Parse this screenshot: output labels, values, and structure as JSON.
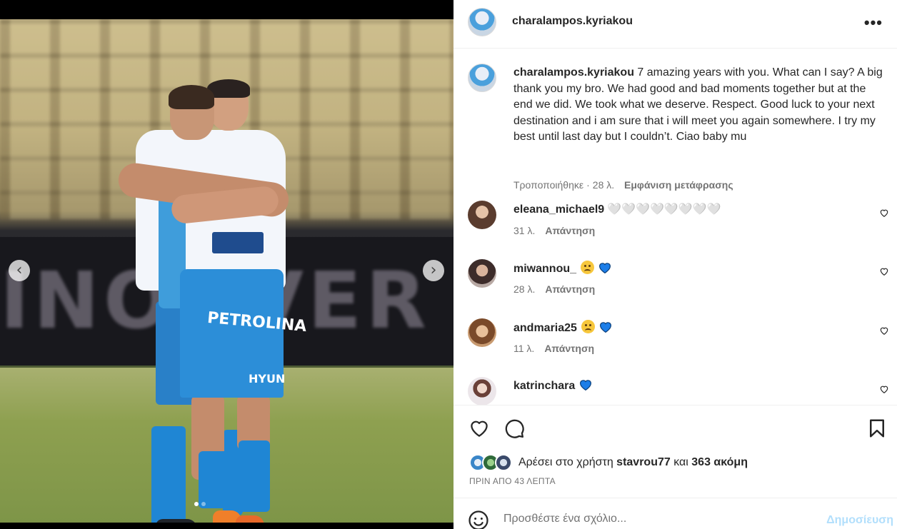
{
  "post": {
    "username": "charalampos.kyriakou",
    "more_label": "•••",
    "caption_text": "7 amazing years with you. What can I say? A big thank you my bro. We had good and bad moments together but at the end we did. We took what we deserve. Respect. Good luck to your next destination and i am sure that i will meet you again somewhere. I try my best until last day but I couldn’t. Ciao baby mu",
    "caption_edited": "Τροποποιήθηκε",
    "caption_age": "28 λ.",
    "translate_label": "Εμφάνιση μετάφρασης",
    "reply_label": "Απάντηση"
  },
  "media": {
    "background_text": "INOUVER P",
    "shorts_sponsor": "PETROLINA",
    "shorts_brand": "HYUN",
    "prev_icon": "chevron-left-icon",
    "next_icon": "chevron-right-icon",
    "page_dots": 2,
    "active_dot": 1
  },
  "comments": [
    {
      "username": "eleana_michael9",
      "text": "🤍🤍🤍🤍🤍🤍🤍🤍",
      "age": "31 λ.",
      "avatar_color": "#7a5a48",
      "emojis": []
    },
    {
      "username": "miwannou_",
      "text": "",
      "age": "28 λ.",
      "avatar_color": "#8a6a62",
      "emojis": [
        "pleading-face-emoji",
        "blue-heart-emoji"
      ]
    },
    {
      "username": "andmaria25",
      "text": "",
      "age": "11 λ.",
      "avatar_color": "#b07a55",
      "emojis": [
        "sad-face-emoji",
        "blue-heart-emoji"
      ]
    },
    {
      "username": "katrinchara",
      "text": "",
      "age": "",
      "avatar_color": "#e6dfe3",
      "emojis": [
        "blue-heart-emoji"
      ]
    }
  ],
  "actions": {
    "like_icon": "heart-icon",
    "comment_icon": "comment-icon",
    "save_icon": "bookmark-icon",
    "likes_prefix": "Αρέσει στο χρήστη",
    "liked_by": "stavrou77",
    "likes_and": "και",
    "likes_others": "363 ακόμη",
    "timestamp": "ΠΡΙΝ ΑΠΟ 43 ΛΕΠΤΑ"
  },
  "add_comment": {
    "placeholder": "Προσθέστε ένα σχόλιο...",
    "post_label": "Δημοσίευση",
    "emoji_icon": "smiley-icon"
  },
  "colors": {
    "heart_blue": "#1d7ee8",
    "post_button_disabled": "#b2dffc",
    "secondary_text": "#737373"
  }
}
